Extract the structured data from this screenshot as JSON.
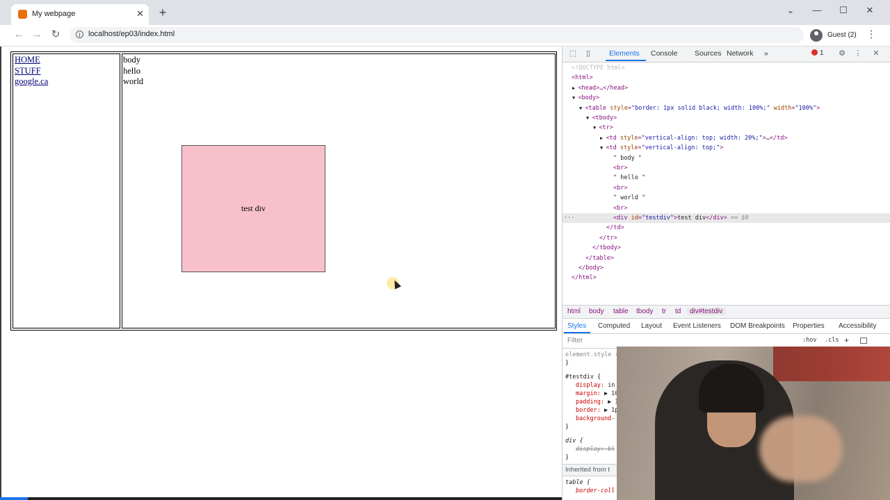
{
  "browser": {
    "tab_title": "My webpage",
    "tab_close": "✕",
    "new_tab": "+",
    "url": "localhost/ep03/index.html",
    "profile_label": "Guest (2)",
    "window_controls": {
      "minimize": "—",
      "maximize": "☐",
      "close": "✕",
      "tabsearch": "⌄"
    },
    "nav": {
      "back": "←",
      "forward": "→",
      "reload": "↻"
    },
    "menu": "⋮"
  },
  "page": {
    "nav_links": [
      "HOME",
      "STUFF",
      "google.ca"
    ],
    "main_lines": [
      "body",
      "hello",
      "world"
    ],
    "test_div_text": "test div"
  },
  "devtools": {
    "tabs": [
      "Elements",
      "Console",
      "Sources",
      "Network"
    ],
    "more_tabs": "»",
    "error_count": "1",
    "dom_lines": [
      {
        "indent": 0,
        "html": "<!DOCTYPE html>",
        "faded": true
      },
      {
        "indent": 0,
        "html": "<html>"
      },
      {
        "indent": 1,
        "arrow": "▶",
        "html": "<head>…</head>"
      },
      {
        "indent": 1,
        "arrow": "▼",
        "html": "<body>"
      },
      {
        "indent": 2,
        "arrow": "▼",
        "tag": "table",
        "attrs": [
          [
            "style",
            "border: 1px solid black; width: 100%;"
          ],
          [
            "width",
            "100%"
          ]
        ]
      },
      {
        "indent": 3,
        "arrow": "▼",
        "html": "<tbody>"
      },
      {
        "indent": 4,
        "arrow": "▼",
        "html": "<tr>"
      },
      {
        "indent": 5,
        "arrow": "▶",
        "tag": "td",
        "attrs": [
          [
            "style",
            "vertical-align: top; width: 20%;"
          ]
        ],
        "suffix": "…</td>"
      },
      {
        "indent": 5,
        "arrow": "▼",
        "tag": "td",
        "attrs": [
          [
            "style",
            "vertical-align: top;"
          ]
        ]
      },
      {
        "indent": 6,
        "text": "\" body \""
      },
      {
        "indent": 6,
        "html": "<br>"
      },
      {
        "indent": 6,
        "text": "\" hello \""
      },
      {
        "indent": 6,
        "html": "<br>"
      },
      {
        "indent": 6,
        "text": "\" world \""
      },
      {
        "indent": 6,
        "html": "<br>"
      },
      {
        "indent": 6,
        "tag": "div",
        "attrs": [
          [
            "id",
            "testdiv"
          ]
        ],
        "suffix": "test div</div>",
        "after": " == $0",
        "selected": true
      },
      {
        "indent": 5,
        "html": "</td>"
      },
      {
        "indent": 4,
        "html": "</tr>"
      },
      {
        "indent": 3,
        "html": "</tbody>"
      },
      {
        "indent": 2,
        "html": "</table>"
      },
      {
        "indent": 1,
        "html": "</body>"
      },
      {
        "indent": 0,
        "html": "</html>"
      }
    ],
    "breadcrumbs": [
      "html",
      "body",
      "table",
      "tbody",
      "tr",
      "td",
      "div#testdiv"
    ],
    "styles_tabs": [
      "Styles",
      "Computed",
      "Layout",
      "Event Listeners",
      "DOM Breakpoints",
      "Properties",
      "Accessibility"
    ],
    "filter_placeholder": "Filter",
    "hov": ":hov",
    "cls": ".cls",
    "plus": "+",
    "rules": {
      "element_style": "element.style {",
      "close": "}",
      "testdiv_selector": "#testdiv {",
      "testdiv_props": [
        {
          "name": "display",
          "value": "in"
        },
        {
          "name": "margin",
          "value": "▶ 10"
        },
        {
          "name": "padding",
          "value": "▶ 1"
        },
        {
          "name": "border",
          "value": "▶ 1p"
        },
        {
          "name": "background-",
          "value": ""
        }
      ],
      "div_selector": "div {",
      "div_prop": "display: bl",
      "inherited": "Inherited from t",
      "table_selector": "table {",
      "table_prop": "border-coll"
    }
  },
  "colors": {
    "test_div_bg": "#f8c0cb",
    "devtools_accent": "#1a73e8",
    "error": "#d93025"
  }
}
